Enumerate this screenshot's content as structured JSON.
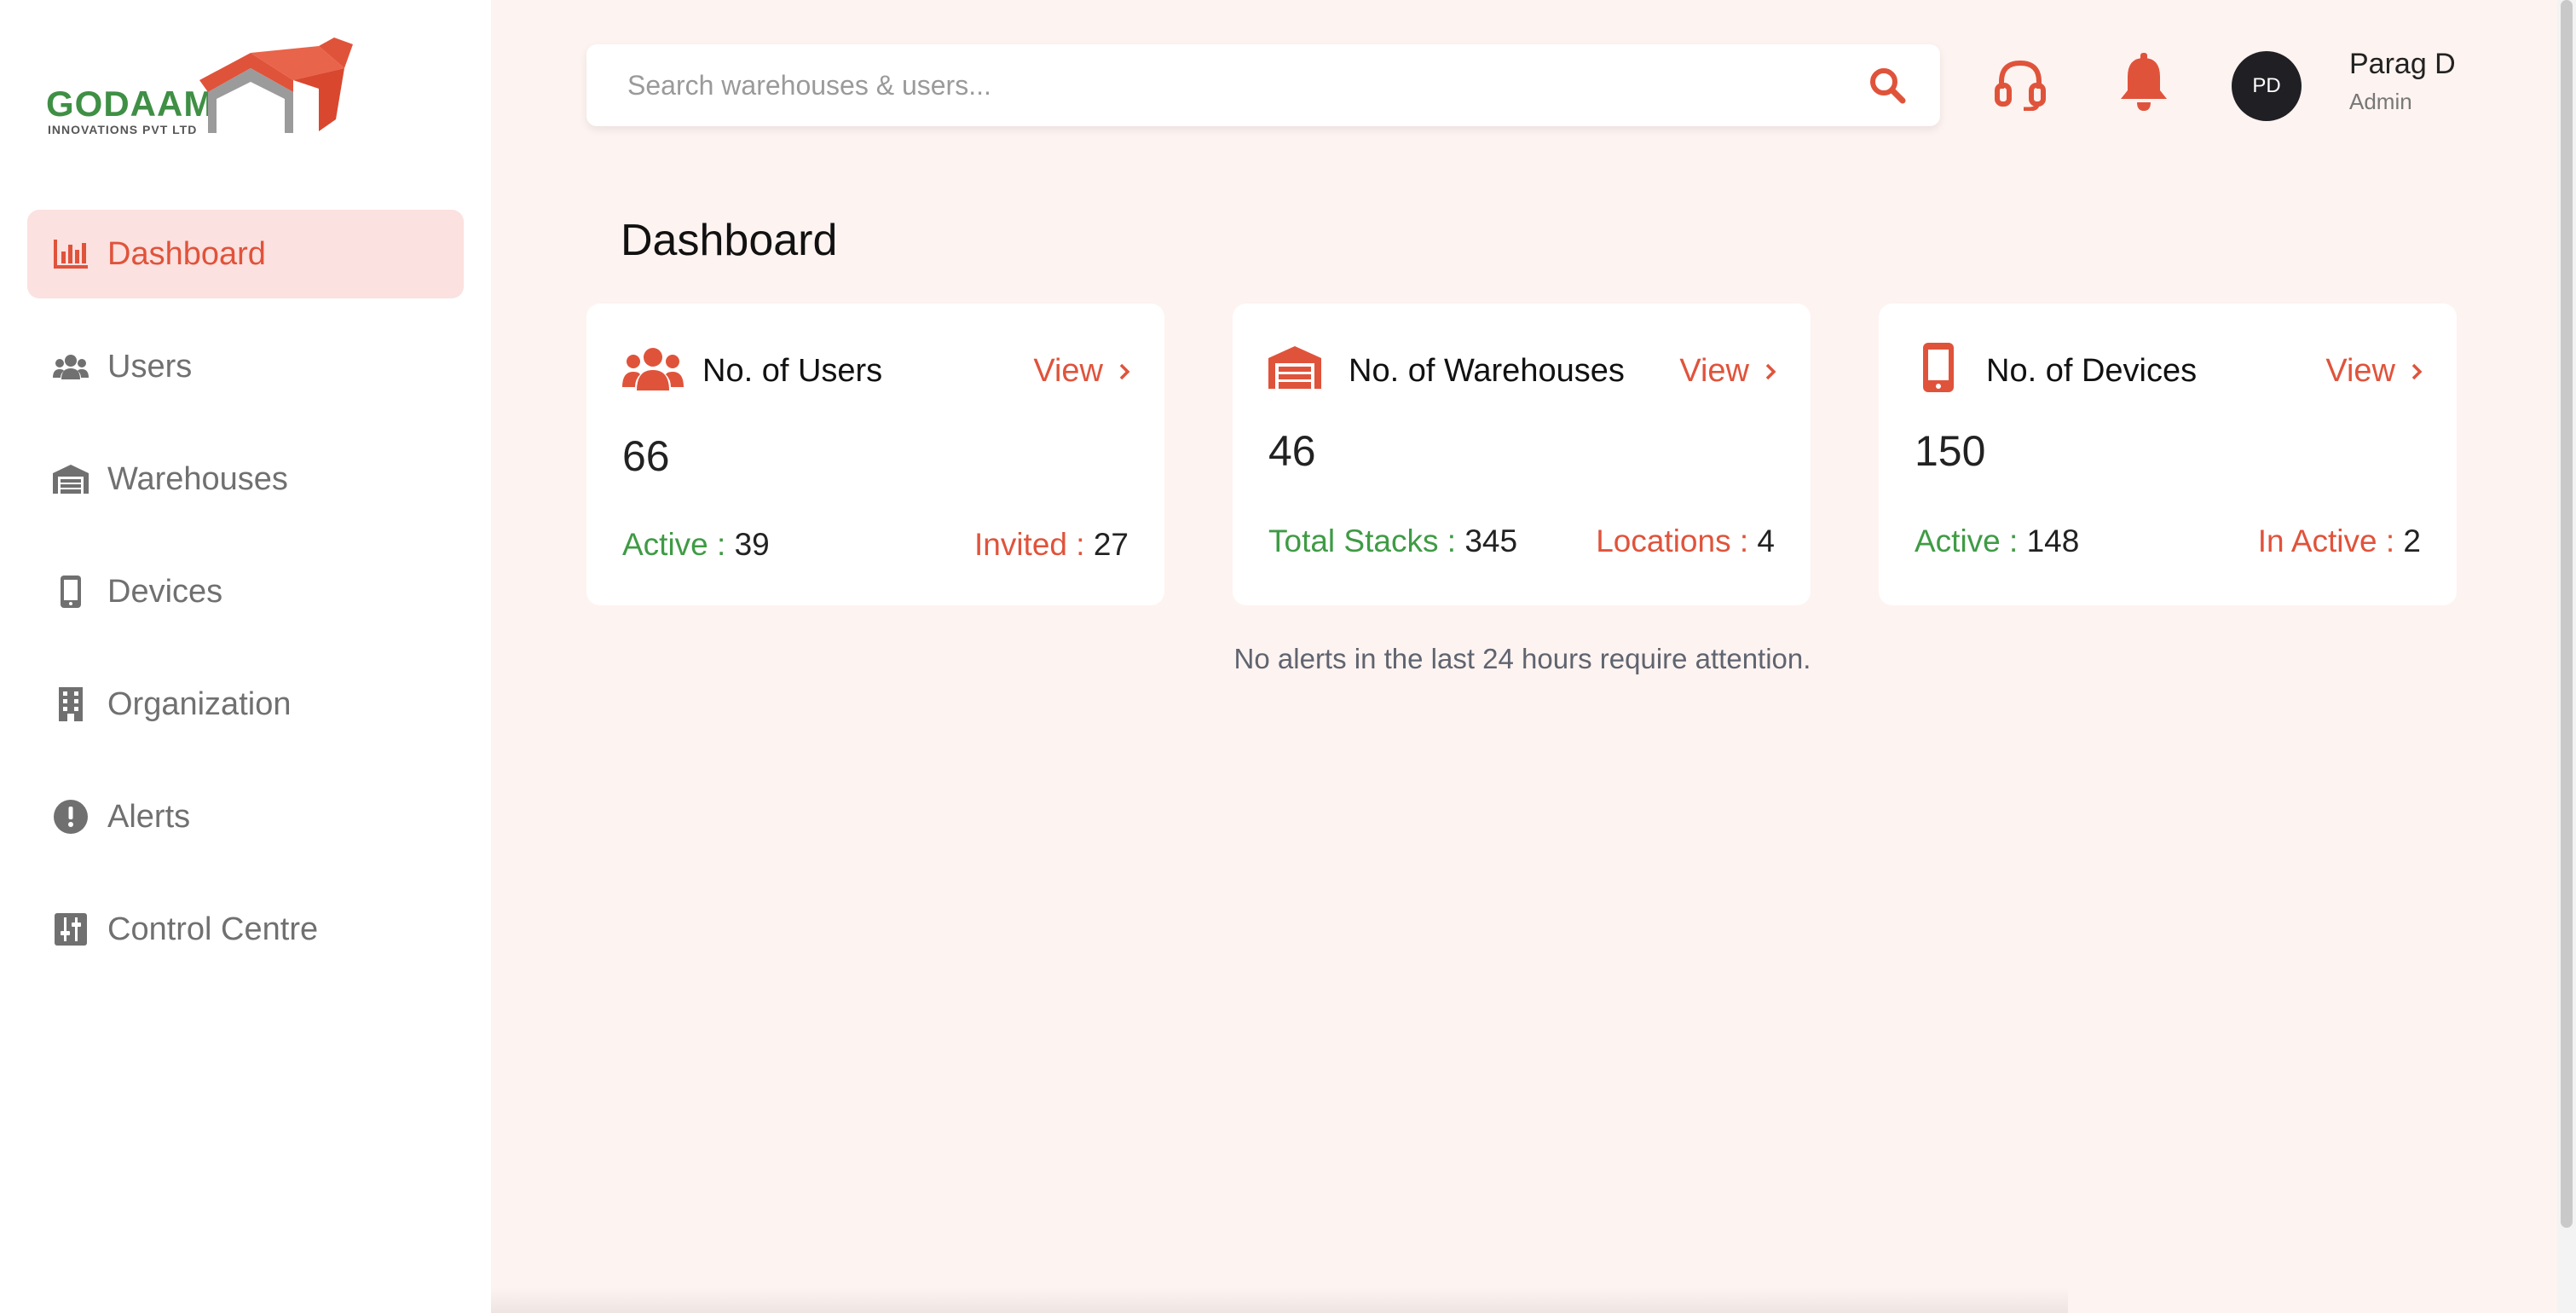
{
  "brand": {
    "name": "GODAAM",
    "subtitle": "INNOVATIONS PVT LTD",
    "logo_icon": "warehouse-roof-logo"
  },
  "sidebar": {
    "items": [
      {
        "label": "Dashboard",
        "icon": "bar-chart-icon",
        "active": true
      },
      {
        "label": "Users",
        "icon": "users-icon",
        "active": false
      },
      {
        "label": "Warehouses",
        "icon": "warehouse-icon",
        "active": false
      },
      {
        "label": "Devices",
        "icon": "mobile-icon",
        "active": false
      },
      {
        "label": "Organization",
        "icon": "building-icon",
        "active": false
      },
      {
        "label": "Alerts",
        "icon": "exclamation-circle-icon",
        "active": false
      },
      {
        "label": "Control Centre",
        "icon": "sliders-icon",
        "active": false
      }
    ]
  },
  "search": {
    "placeholder": "Search warehouses & users...",
    "value": ""
  },
  "user": {
    "initials": "PD",
    "name": "Parag D",
    "role": "Admin"
  },
  "page": {
    "title": "Dashboard",
    "no_alerts_text": "No alerts in the last 24 hours require attention."
  },
  "cards": [
    {
      "title": "No. of Users",
      "icon": "users-icon",
      "view_label": "View",
      "count": "66",
      "left_label": "Active : ",
      "left_value": "39",
      "right_label": "Invited : ",
      "right_value": "27"
    },
    {
      "title": "No. of Warehouses",
      "icon": "warehouse-icon",
      "view_label": "View",
      "count": "46",
      "left_label": "Total Stacks : ",
      "left_value": "345",
      "right_label": "Locations : ",
      "right_value": "4"
    },
    {
      "title": "No. of Devices",
      "icon": "mobile-icon",
      "view_label": "View",
      "count": "150",
      "left_label": "Active : ",
      "left_value": "148",
      "right_label": "In Active : ",
      "right_value": "2"
    }
  ],
  "colors": {
    "accent": "#e0533b",
    "active_bg": "#fbe1df",
    "green": "#3f9b45",
    "background": "#fdf3f0"
  }
}
